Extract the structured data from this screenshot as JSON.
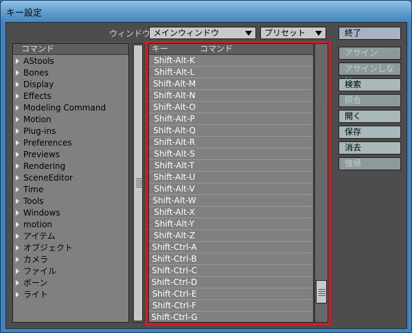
{
  "window": {
    "title": "キー設定"
  },
  "toolbar": {
    "window_label": "ウィンドウ",
    "window_select_value": "メインウィンドウ",
    "preset_select_value": "プリセット"
  },
  "buttons": [
    {
      "label": "終了",
      "enabled": true,
      "name": "end-button",
      "style": "end"
    },
    {
      "label": "アサイン",
      "enabled": false,
      "name": "assign-button",
      "style": "disabled"
    },
    {
      "label": "アサインしない",
      "enabled": false,
      "name": "unassign-button",
      "style": "disabled"
    },
    {
      "label": "検索",
      "enabled": true,
      "name": "search-button",
      "style": "normal"
    },
    {
      "label": "照合",
      "enabled": false,
      "name": "compare-button",
      "style": "disabled"
    },
    {
      "label": "開く",
      "enabled": true,
      "name": "open-button",
      "style": "normal"
    },
    {
      "label": "保存",
      "enabled": true,
      "name": "save-button",
      "style": "normal"
    },
    {
      "label": "消去",
      "enabled": true,
      "name": "clear-button",
      "style": "normal"
    },
    {
      "label": "復帰",
      "enabled": false,
      "name": "revert-button",
      "style": "disabled"
    }
  ],
  "command_list": {
    "header": "コマンド",
    "items": [
      "AStools",
      "Bones",
      "Display",
      "Effects",
      "Modeling Command",
      "Motion",
      "Plug-ins",
      "Preferences",
      "Previews",
      "Rendering",
      "SceneEditor",
      "Time",
      "Tools",
      "Windows",
      "motion",
      "アイテム",
      "オブジェクト",
      "カメラ",
      "ファイル",
      "ボーン",
      "ライト"
    ]
  },
  "key_list": {
    "header_key": "キー",
    "header_command": "コマンド",
    "rows": [
      "Shift-Alt-K",
      "Shift-Alt-L",
      "Shift-Alt-M",
      "Shift-Alt-N",
      "Shift-Alt-O",
      "Shift-Alt-P",
      "Shift-Alt-Q",
      "Shift-Alt-R",
      "Shift-Alt-S",
      "Shift-Alt-T",
      "Shift-Alt-U",
      "Shift-Alt-V",
      "Shift-Alt-W",
      "Shift-Alt-X",
      "Shift-Alt-Y",
      "Shift-Alt-Z",
      "Shift-Ctrl-A",
      "Shift-Ctrl-B",
      "Shift-Ctrl-C",
      "Shift-Ctrl-D",
      "Shift-Ctrl-E",
      "Shift-Ctrl-F",
      "Shift-Ctrl-G"
    ]
  },
  "colors": {
    "highlight": "#e0161c"
  }
}
